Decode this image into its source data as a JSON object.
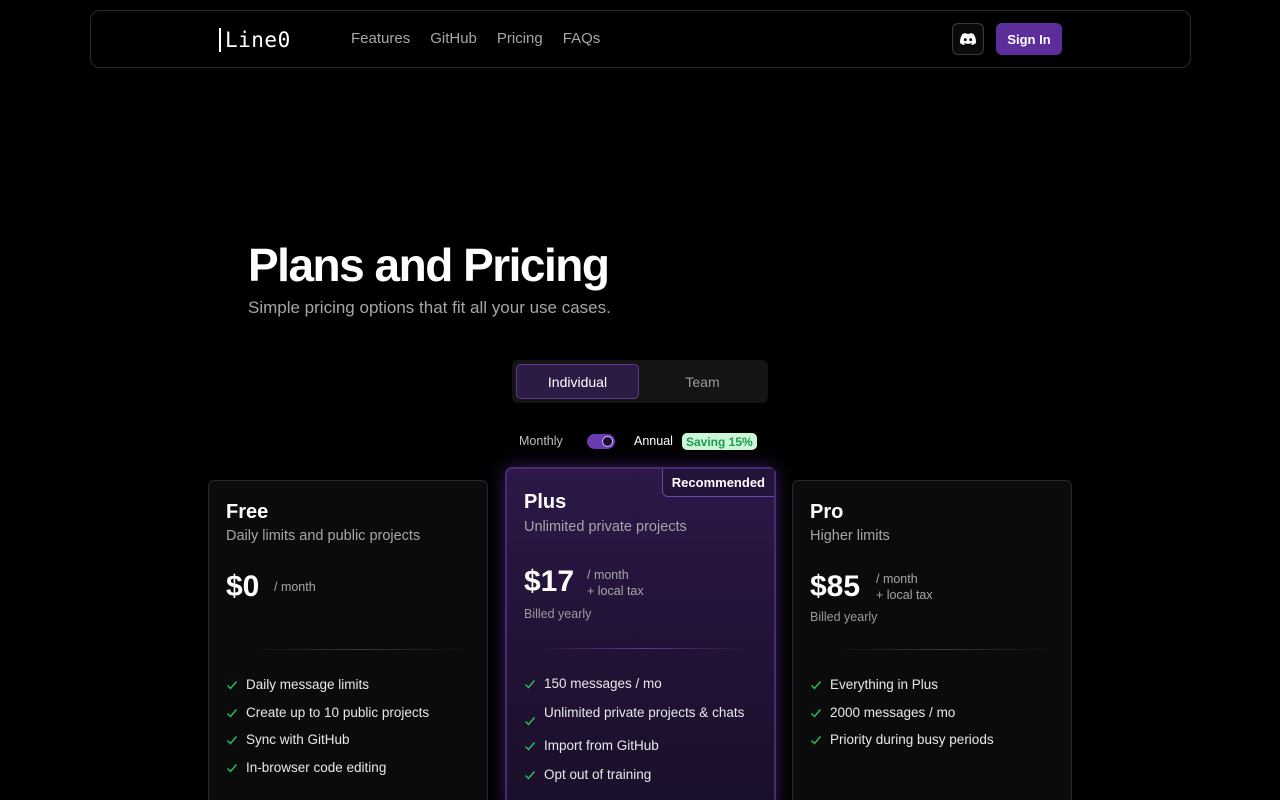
{
  "nav": {
    "logo_text": "Line",
    "logo_suffix": "0",
    "links": [
      "Features",
      "GitHub",
      "Pricing",
      "FAQs"
    ],
    "discord_icon": "discord-icon",
    "signin_label": "Sign In",
    "signin_color": "#5b2e9c"
  },
  "hero": {
    "title": "Plans and Pricing",
    "subtitle": "Simple pricing options that fit all your use cases."
  },
  "tabs": {
    "options": [
      "Individual",
      "Team"
    ],
    "active": "Individual"
  },
  "billing": {
    "monthly_label": "Monthly",
    "annual_label": "Annual",
    "annual_selected": true,
    "saving_badge": "Saving 15%"
  },
  "plans": [
    {
      "name": "Free",
      "description": "Daily limits and public projects",
      "price": "$0",
      "per": "/ month",
      "tax": "",
      "billed": "",
      "features": [
        "Daily message limits",
        "Create up to 10 public projects",
        "Sync with GitHub",
        "In-browser code editing"
      ]
    },
    {
      "name": "Plus",
      "badge": "Recommended",
      "description": "Unlimited private projects",
      "price": "$17",
      "per": "/ month",
      "tax": "+ local tax",
      "billed": "Billed yearly",
      "features": [
        "150 messages / mo",
        "Unlimited private projects & chats",
        "Import from GitHub",
        "Opt out of training"
      ]
    },
    {
      "name": "Pro",
      "description": "Higher limits",
      "price": "$85",
      "per": "/ month",
      "tax": "+ local tax",
      "billed": "Billed yearly",
      "features": [
        "Everything in Plus",
        "2000 messages / mo",
        "Priority during busy periods"
      ]
    }
  ],
  "colors": {
    "accent": "#6b3bb0",
    "check": "#22c55e",
    "badge_bg": "#cdf5d9",
    "badge_text": "#1d9c4a"
  }
}
